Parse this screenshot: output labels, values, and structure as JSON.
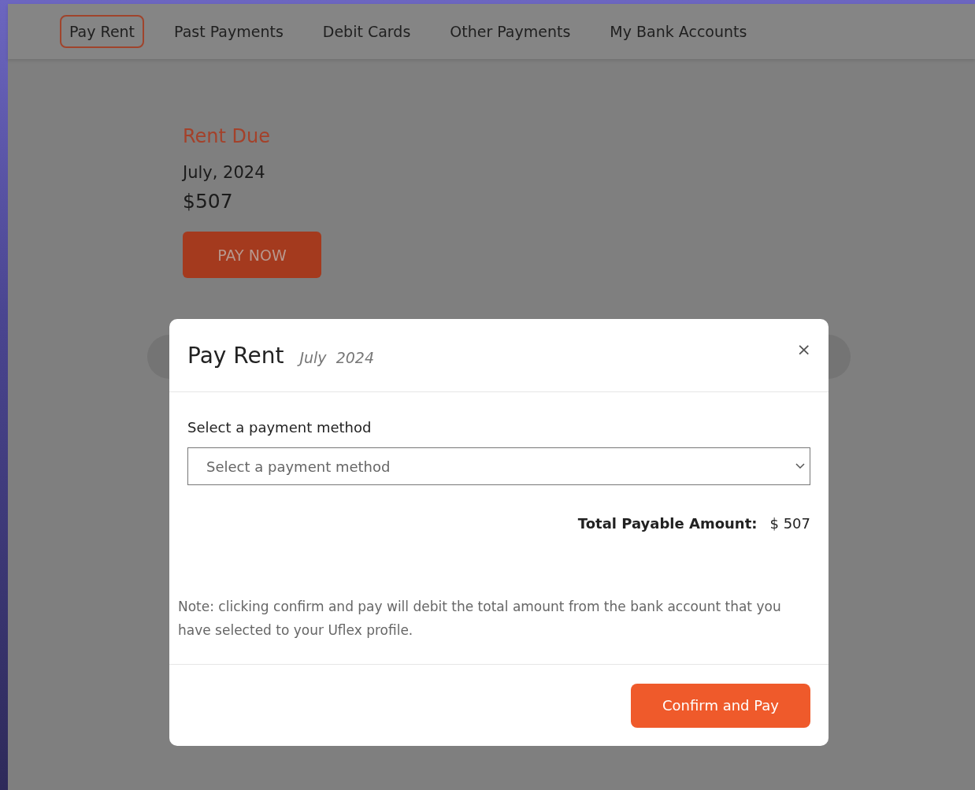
{
  "tabs": [
    {
      "label": "Pay Rent",
      "selected": true
    },
    {
      "label": "Past Payments",
      "selected": false
    },
    {
      "label": "Debit Cards",
      "selected": false
    },
    {
      "label": "Other Payments",
      "selected": false
    },
    {
      "label": "My Bank Accounts",
      "selected": false
    }
  ],
  "rent_due": {
    "heading": "Rent Due",
    "period": "July, 2024",
    "amount": "$507",
    "pay_button": "PAY NOW"
  },
  "modal": {
    "title": "Pay Rent",
    "subtitle": "July  2024",
    "close": "×",
    "field_label": "Select a payment method",
    "select": {
      "placeholder": "Select a payment method"
    },
    "total_label": "Total Payable Amount:",
    "total_value": "$ 507",
    "note": "Note: clicking confirm and pay will debit the total amount from the bank account that you have selected to your Uflex profile.",
    "confirm_button": "Confirm and Pay"
  }
}
